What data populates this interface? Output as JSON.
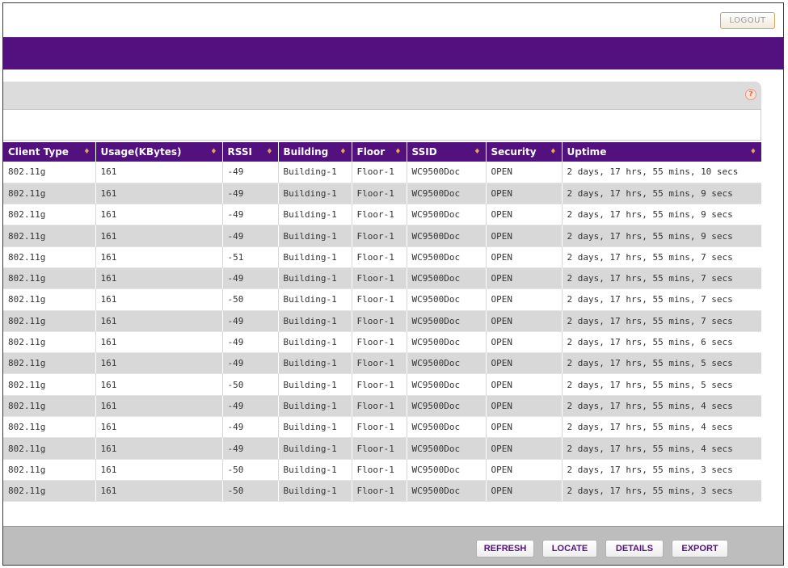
{
  "header": {
    "logout_label": "LOGOUT"
  },
  "help": {
    "icon": "help-icon",
    "glyph": "?"
  },
  "table": {
    "columns": [
      {
        "label": "Client Type",
        "sort_icon": "♦"
      },
      {
        "label": "Usage(KBytes)",
        "sort_icon": "♦"
      },
      {
        "label": "RSSI",
        "sort_icon": "♦"
      },
      {
        "label": "Building",
        "sort_icon": "♦"
      },
      {
        "label": "Floor",
        "sort_icon": "♦"
      },
      {
        "label": "SSID",
        "sort_icon": "♦"
      },
      {
        "label": "Security",
        "sort_icon": "♦"
      },
      {
        "label": "Uptime",
        "sort_icon": "♦"
      }
    ],
    "rows": [
      [
        "802.11g",
        "161",
        "-49",
        "Building-1",
        "Floor-1",
        "WC9500Doc",
        "OPEN",
        "2 days, 17 hrs, 55 mins, 10 secs"
      ],
      [
        "802.11g",
        "161",
        "-49",
        "Building-1",
        "Floor-1",
        "WC9500Doc",
        "OPEN",
        "2 days, 17 hrs, 55 mins, 9 secs"
      ],
      [
        "802.11g",
        "161",
        "-49",
        "Building-1",
        "Floor-1",
        "WC9500Doc",
        "OPEN",
        "2 days, 17 hrs, 55 mins, 9 secs"
      ],
      [
        "802.11g",
        "161",
        "-49",
        "Building-1",
        "Floor-1",
        "WC9500Doc",
        "OPEN",
        "2 days, 17 hrs, 55 mins, 9 secs"
      ],
      [
        "802.11g",
        "161",
        "-51",
        "Building-1",
        "Floor-1",
        "WC9500Doc",
        "OPEN",
        "2 days, 17 hrs, 55 mins, 7 secs"
      ],
      [
        "802.11g",
        "161",
        "-49",
        "Building-1",
        "Floor-1",
        "WC9500Doc",
        "OPEN",
        "2 days, 17 hrs, 55 mins, 7 secs"
      ],
      [
        "802.11g",
        "161",
        "-50",
        "Building-1",
        "Floor-1",
        "WC9500Doc",
        "OPEN",
        "2 days, 17 hrs, 55 mins, 7 secs"
      ],
      [
        "802.11g",
        "161",
        "-49",
        "Building-1",
        "Floor-1",
        "WC9500Doc",
        "OPEN",
        "2 days, 17 hrs, 55 mins, 7 secs"
      ],
      [
        "802.11g",
        "161",
        "-49",
        "Building-1",
        "Floor-1",
        "WC9500Doc",
        "OPEN",
        "2 days, 17 hrs, 55 mins, 6 secs"
      ],
      [
        "802.11g",
        "161",
        "-49",
        "Building-1",
        "Floor-1",
        "WC9500Doc",
        "OPEN",
        "2 days, 17 hrs, 55 mins, 5 secs"
      ],
      [
        "802.11g",
        "161",
        "-50",
        "Building-1",
        "Floor-1",
        "WC9500Doc",
        "OPEN",
        "2 days, 17 hrs, 55 mins, 5 secs"
      ],
      [
        "802.11g",
        "161",
        "-49",
        "Building-1",
        "Floor-1",
        "WC9500Doc",
        "OPEN",
        "2 days, 17 hrs, 55 mins, 4 secs"
      ],
      [
        "802.11g",
        "161",
        "-49",
        "Building-1",
        "Floor-1",
        "WC9500Doc",
        "OPEN",
        "2 days, 17 hrs, 55 mins, 4 secs"
      ],
      [
        "802.11g",
        "161",
        "-49",
        "Building-1",
        "Floor-1",
        "WC9500Doc",
        "OPEN",
        "2 days, 17 hrs, 55 mins, 4 secs"
      ],
      [
        "802.11g",
        "161",
        "-50",
        "Building-1",
        "Floor-1",
        "WC9500Doc",
        "OPEN",
        "2 days, 17 hrs, 55 mins, 3 secs"
      ],
      [
        "802.11g",
        "161",
        "-50",
        "Building-1",
        "Floor-1",
        "WC9500Doc",
        "OPEN",
        "2 days, 17 hrs, 55 mins, 3 secs"
      ]
    ]
  },
  "footer": {
    "refresh_label": "REFRESH",
    "locate_label": "LOCATE",
    "details_label": "DETAILS",
    "export_label": "EXPORT"
  },
  "colors": {
    "accent": "#53107f",
    "sort_icon": "#e8a25a",
    "row_alt": "#d8d8d8",
    "footer": "#bdbdbd"
  }
}
